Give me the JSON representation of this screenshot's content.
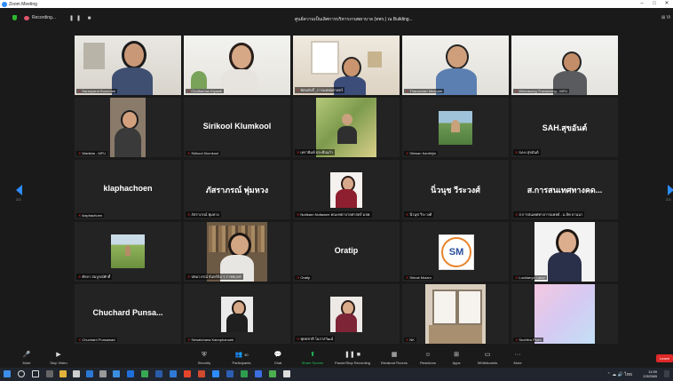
{
  "window": {
    "title": "Zoom Meeting",
    "controls": [
      "–",
      "□",
      "✕"
    ]
  },
  "topbar": {
    "recording_label": "Recording...",
    "meeting_title": "ศูนย์ความเป็นเลิศการบริหารงานพยาบาล (ทพร.) ณ Building...",
    "view_label": "Vi"
  },
  "pagination": {
    "left": "2/3",
    "right": "2/3"
  },
  "tiles": [
    {
      "label": "Saranyarut Boonmee",
      "type": "video"
    },
    {
      "label": "Chuthamas Kiyawit",
      "type": "video"
    },
    {
      "label": "ทัศนศักดิ์ _การแพทยศาสตร์",
      "type": "video"
    },
    {
      "label": "Thanachart Meepum",
      "type": "video"
    },
    {
      "label": "Weerasong Thanawong - MFU",
      "type": "video"
    },
    {
      "label": "Wantida - MFU",
      "type": "video"
    },
    {
      "label": "Sirikool Klumkool",
      "type": "name",
      "name": "Sirikool Klumkool"
    },
    {
      "label": "เพราพิมพ์ ประทีปแก้ว",
      "type": "photo"
    },
    {
      "label": "Siriwan Kanthijin",
      "type": "photo"
    },
    {
      "label": "SAH.สุขอันต์",
      "type": "name",
      "name": "SAH.สุขอันต์"
    },
    {
      "label": "klaphachoen",
      "type": "name",
      "name": "klaphachoen"
    },
    {
      "label": "ภัสราภรณ์ พุ่มหวง",
      "type": "name",
      "name": "ภัสราภรณ์ พุ่มหวง"
    },
    {
      "label": "Nuttkarn Nottawee คณะพยาบาลศาสตร์ มจพ.",
      "type": "photo"
    },
    {
      "label": "นิ่วนุช วีระวงศ์",
      "type": "name",
      "name": "นิ่วนุช วีระวงศ์"
    },
    {
      "label": "ส.การสนเทศทางการแพทย์ - ม.ลิพ ลานนา",
      "type": "name",
      "name": "ส.การสนเทศทางคด..."
    },
    {
      "label": "ศักดา สมบูรณ์ศักดิ์",
      "type": "photo"
    },
    {
      "label": "ปทมาภรณ์ จันทร์นิล ร.ราชพฤกษ์",
      "type": "video"
    },
    {
      "label": "Oratip",
      "type": "name",
      "name": "Oratip"
    },
    {
      "label": "Sirirak Mulam",
      "type": "logo",
      "logo": "SM"
    },
    {
      "label": "Lucktanya Laksri",
      "type": "photo"
    },
    {
      "label": "Chuchard Punsawad",
      "type": "name",
      "name": "Chuchard Punsa..."
    },
    {
      "label": "Sriwatchana Kaeophanuek",
      "type": "photo"
    },
    {
      "label": "พุทธชาติ โอภาสวัฒน์",
      "type": "photo"
    },
    {
      "label": "NK",
      "type": "photo"
    },
    {
      "label": "Suchitra Prom",
      "type": "photo"
    }
  ],
  "toolbar": {
    "mute": "Mute",
    "stop_video": "Stop Video",
    "security": "Security",
    "participants": "Participants",
    "participants_count": "30",
    "chat": "Chat",
    "share_screen": "Share Screen",
    "pause_recording": "Pause/Stop Recording",
    "breakout": "Breakout Rooms",
    "reactions": "Reactions",
    "apps": "Apps",
    "whiteboards": "Whiteboards",
    "more": "More",
    "end": "Leave"
  },
  "taskbar": {
    "time": "11:59",
    "date": "2/3/2565",
    "tray_text": "ไทย"
  },
  "colors": {
    "accent_blue": "#2d8cff",
    "share_green": "#21c55d",
    "end_red": "#e02828",
    "muted_red": "#e02828"
  }
}
